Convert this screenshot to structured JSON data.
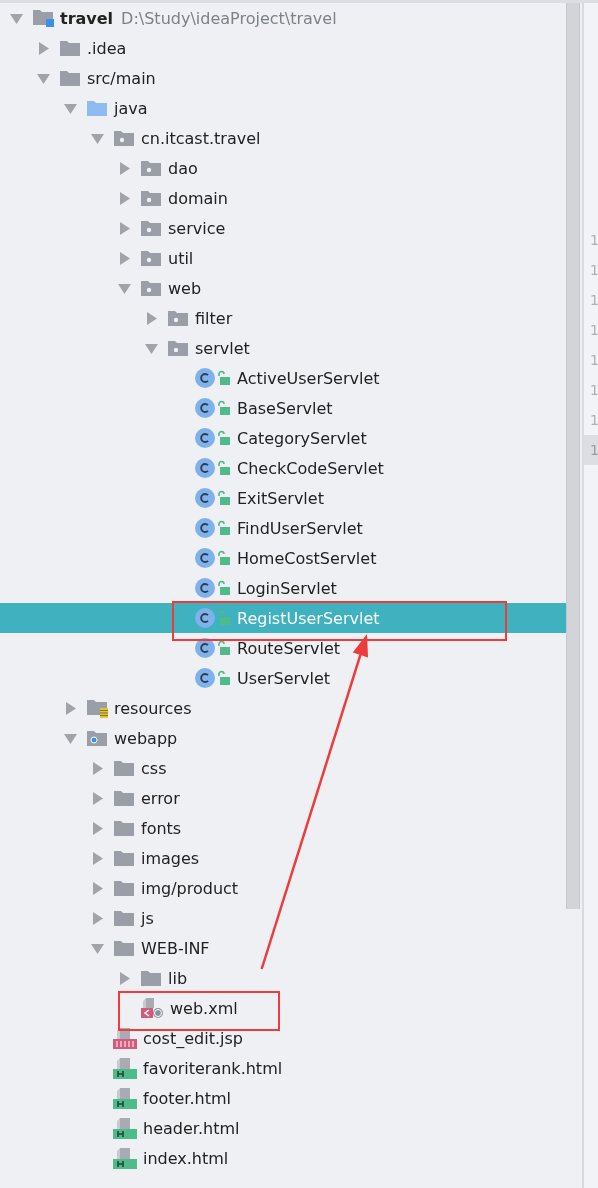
{
  "tree": [
    {
      "label": "travel",
      "path": "D:\\Study\\ideaProject\\travel",
      "kind": "project",
      "expanded": true,
      "selected": false,
      "annotated": false,
      "children": [
        {
          "label": ".idea",
          "kind": "folder",
          "expanded": false,
          "selected": false,
          "annotated": false
        },
        {
          "label": "src/main",
          "kind": "folder",
          "expanded": true,
          "selected": false,
          "annotated": false,
          "children": [
            {
              "label": "java",
              "kind": "source",
              "expanded": true,
              "selected": false,
              "annotated": false,
              "children": [
                {
                  "label": "cn.itcast.travel",
                  "kind": "package",
                  "expanded": true,
                  "selected": false,
                  "annotated": false,
                  "children": [
                    {
                      "label": "dao",
                      "kind": "package",
                      "expanded": false,
                      "selected": false,
                      "annotated": false
                    },
                    {
                      "label": "domain",
                      "kind": "package",
                      "expanded": false,
                      "selected": false,
                      "annotated": false
                    },
                    {
                      "label": "service",
                      "kind": "package",
                      "expanded": false,
                      "selected": false,
                      "annotated": false
                    },
                    {
                      "label": "util",
                      "kind": "package",
                      "expanded": false,
                      "selected": false,
                      "annotated": false
                    },
                    {
                      "label": "web",
                      "kind": "package",
                      "expanded": true,
                      "selected": false,
                      "annotated": false,
                      "children": [
                        {
                          "label": "filter",
                          "kind": "package",
                          "expanded": false,
                          "selected": false,
                          "annotated": false
                        },
                        {
                          "label": "servlet",
                          "kind": "package",
                          "expanded": true,
                          "selected": false,
                          "annotated": false,
                          "children": [
                            {
                              "label": "ActiveUserServlet",
                              "kind": "class",
                              "selected": false,
                              "annotated": false
                            },
                            {
                              "label": "BaseServlet",
                              "kind": "class",
                              "selected": false,
                              "annotated": false
                            },
                            {
                              "label": "CategoryServlet",
                              "kind": "class",
                              "selected": false,
                              "annotated": false
                            },
                            {
                              "label": "CheckCodeServlet",
                              "kind": "class",
                              "selected": false,
                              "annotated": false
                            },
                            {
                              "label": "ExitServlet",
                              "kind": "class",
                              "selected": false,
                              "annotated": false
                            },
                            {
                              "label": "FindUserServlet",
                              "kind": "class",
                              "selected": false,
                              "annotated": false
                            },
                            {
                              "label": "HomeCostServlet",
                              "kind": "class",
                              "selected": false,
                              "annotated": false
                            },
                            {
                              "label": "LoginServlet",
                              "kind": "class",
                              "selected": false,
                              "annotated": false
                            },
                            {
                              "label": "RegistUserServlet",
                              "kind": "class",
                              "selected": true,
                              "annotated": true
                            },
                            {
                              "label": "RouteServlet",
                              "kind": "class",
                              "selected": false,
                              "annotated": false
                            },
                            {
                              "label": "UserServlet",
                              "kind": "class",
                              "selected": false,
                              "annotated": false
                            }
                          ]
                        }
                      ]
                    }
                  ]
                }
              ]
            },
            {
              "label": "resources",
              "kind": "resources",
              "expanded": false,
              "selected": false,
              "annotated": false
            },
            {
              "label": "webapp",
              "kind": "webroot",
              "expanded": true,
              "selected": false,
              "annotated": false,
              "children": [
                {
                  "label": "css",
                  "kind": "folder",
                  "expanded": false,
                  "selected": false,
                  "annotated": false
                },
                {
                  "label": "error",
                  "kind": "folder",
                  "expanded": false,
                  "selected": false,
                  "annotated": false
                },
                {
                  "label": "fonts",
                  "kind": "folder",
                  "expanded": false,
                  "selected": false,
                  "annotated": false
                },
                {
                  "label": "images",
                  "kind": "folder",
                  "expanded": false,
                  "selected": false,
                  "annotated": false
                },
                {
                  "label": "img/product",
                  "kind": "folder",
                  "expanded": false,
                  "selected": false,
                  "annotated": false
                },
                {
                  "label": "js",
                  "kind": "folder",
                  "expanded": false,
                  "selected": false,
                  "annotated": false
                },
                {
                  "label": "WEB-INF",
                  "kind": "folder",
                  "expanded": true,
                  "selected": false,
                  "annotated": false,
                  "children": [
                    {
                      "label": "lib",
                      "kind": "folder",
                      "expanded": false,
                      "selected": false,
                      "annotated": false
                    },
                    {
                      "label": "web.xml",
                      "kind": "xml",
                      "selected": false,
                      "annotated": true
                    }
                  ]
                },
                {
                  "label": "cost_edit.jsp",
                  "kind": "jsp",
                  "selected": false,
                  "annotated": false
                },
                {
                  "label": "favoriterank.html",
                  "kind": "html",
                  "selected": false,
                  "annotated": false
                },
                {
                  "label": "footer.html",
                  "kind": "html",
                  "selected": false,
                  "annotated": false
                },
                {
                  "label": "header.html",
                  "kind": "html",
                  "selected": false,
                  "annotated": false
                },
                {
                  "label": "index.html",
                  "kind": "html",
                  "selected": false,
                  "annotated": false
                }
              ]
            }
          ]
        }
      ]
    }
  ],
  "gutter": {
    "line_numbers": [
      {
        "text": "1",
        "current": false
      },
      {
        "text": "1",
        "current": false
      },
      {
        "text": "1",
        "current": false
      },
      {
        "text": "1",
        "current": false
      },
      {
        "text": "1",
        "current": false
      },
      {
        "text": "1",
        "current": false
      },
      {
        "text": "1",
        "current": false
      },
      {
        "text": "1",
        "current": true
      }
    ]
  },
  "annotation_arrow": true
}
